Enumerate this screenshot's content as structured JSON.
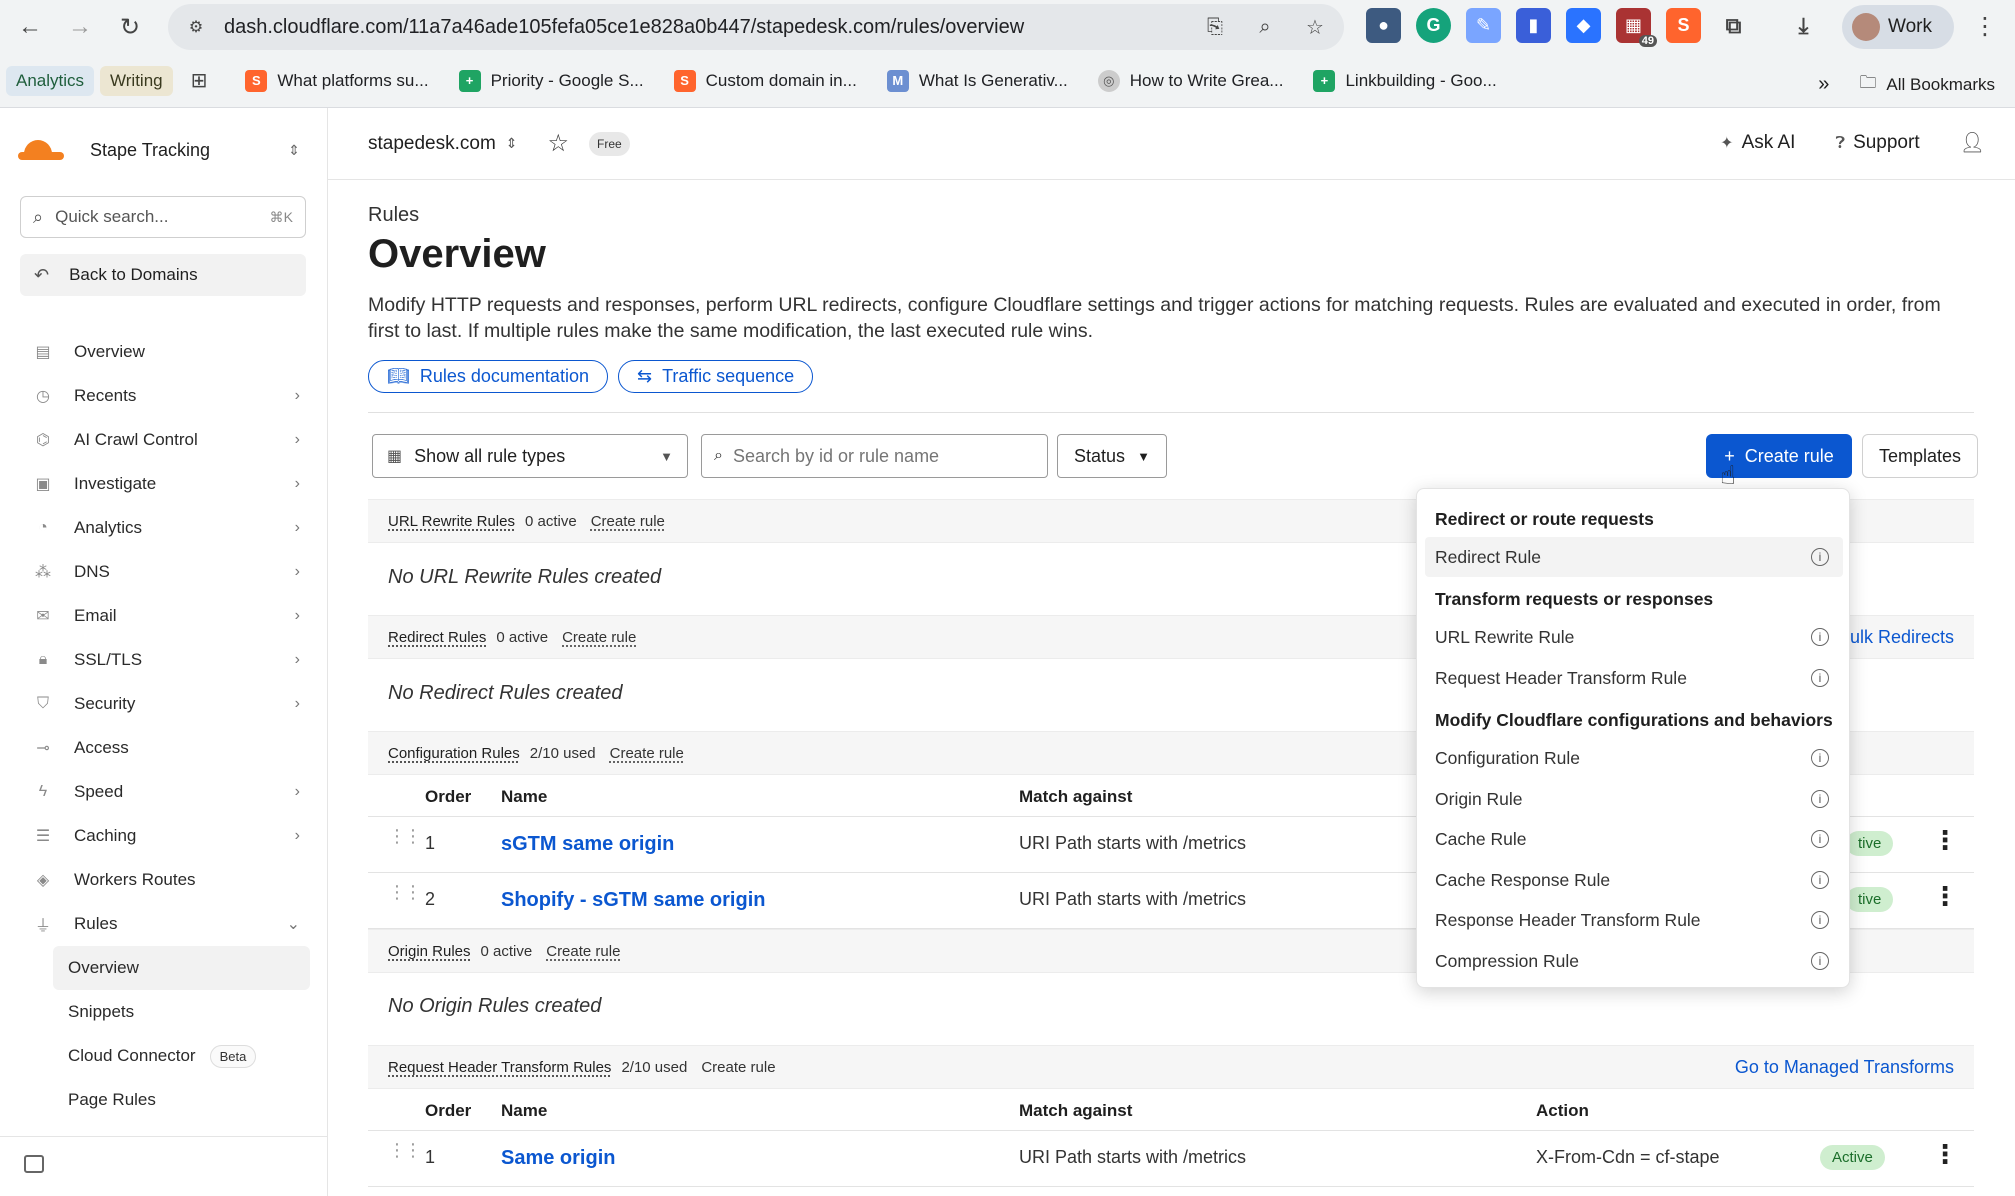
{
  "browser": {
    "url": "dash.cloudflare.com/11a7a46ade105fefa05ce1e828a0b447/stapedesk.com/rules/overview",
    "profile": "Work",
    "ext_badge": "49",
    "bookmarks_chips": [
      "Analytics",
      "Writing"
    ],
    "bookmarks": [
      "What platforms su...",
      "Priority - Google S...",
      "Custom domain in...",
      "What Is Generativ...",
      "How to Write Grea...",
      "Linkbuilding - Goo..."
    ],
    "all_bookmarks": "All Bookmarks"
  },
  "sidebar": {
    "account": "Stape Tracking",
    "search_placeholder": "Quick search...",
    "search_kbd": "⌘K",
    "back": "Back to Domains",
    "items": [
      {
        "label": "Overview",
        "icon": "document-icon",
        "chev": false
      },
      {
        "label": "Recents",
        "icon": "clock-icon",
        "chev": true
      },
      {
        "label": "AI Crawl Control",
        "icon": "robot-icon",
        "chev": true
      },
      {
        "label": "Investigate",
        "icon": "file-search-icon",
        "chev": true
      },
      {
        "label": "Analytics",
        "icon": "pie-icon",
        "chev": true
      },
      {
        "label": "DNS",
        "icon": "network-icon",
        "chev": true
      },
      {
        "label": "Email",
        "icon": "mail-icon",
        "chev": true
      },
      {
        "label": "SSL/TLS",
        "icon": "lock-icon",
        "chev": true
      },
      {
        "label": "Security",
        "icon": "shield-icon",
        "chev": true
      },
      {
        "label": "Access",
        "icon": "access-icon",
        "chev": false
      },
      {
        "label": "Speed",
        "icon": "bolt-icon",
        "chev": true
      },
      {
        "label": "Caching",
        "icon": "stack-icon",
        "chev": true
      },
      {
        "label": "Workers Routes",
        "icon": "workers-icon",
        "chev": false
      },
      {
        "label": "Rules",
        "icon": "funnel-icon",
        "chev": true
      }
    ],
    "sub_items": [
      "Overview",
      "Snippets",
      "Cloud Connector",
      "Page Rules"
    ],
    "beta": "Beta"
  },
  "topbar": {
    "domain": "stapedesk.com",
    "plan": "Free",
    "ask_ai": "Ask AI",
    "support": "Support"
  },
  "page": {
    "breadcrumb": "Rules",
    "title": "Overview",
    "description": "Modify HTTP requests and responses, perform URL redirects, configure Cloudflare settings and trigger actions for matching requests. Rules are evaluated and executed in order, from first to last. If multiple rules make the same modification, the last executed rule wins.",
    "docs_button": "Rules documentation",
    "traffic_button": "Traffic sequence",
    "filter_select": "Show all rule types",
    "search_placeholder": "Search by id or rule name",
    "status": "Status",
    "create_rule": "Create rule",
    "templates": "Templates"
  },
  "sections": {
    "url_rewrite": {
      "name": "URL Rewrite Rules",
      "count": "0 active",
      "create": "Create rule",
      "empty": "No URL Rewrite Rules created"
    },
    "redirect": {
      "name": "Redirect Rules",
      "count": "0 active",
      "create": "Create rule",
      "empty": "No Redirect Rules created",
      "link": "ulk Redirects"
    },
    "configuration": {
      "name": "Configuration Rules",
      "count": "2/10 used",
      "create": "Create rule"
    },
    "origin": {
      "name": "Origin Rules",
      "count": "0 active",
      "create": "Create rule",
      "empty": "No Origin Rules created"
    },
    "req_header": {
      "name": "Request Header Transform Rules",
      "count": "2/10 used",
      "create": "Create rule",
      "link": "Go to Managed Transforms"
    }
  },
  "columns": {
    "order": "Order",
    "name": "Name",
    "match": "Match against",
    "action": "Action"
  },
  "config_rows": [
    {
      "order": "1",
      "name": "sGTM same origin",
      "match": "URI Path starts with /metrics",
      "status": "tive"
    },
    {
      "order": "2",
      "name": "Shopify - sGTM same origin",
      "match": "URI Path starts with /metrics",
      "status": "tive"
    }
  ],
  "header_rows": [
    {
      "order": "1",
      "name": "Same origin",
      "match": "URI Path starts with /metrics",
      "action": "X-From-Cdn = cf-stape",
      "status": "Active"
    }
  ],
  "dropdown": {
    "groups": [
      {
        "title": "Redirect or route requests",
        "items": [
          "Redirect Rule"
        ]
      },
      {
        "title": "Transform requests or responses",
        "items": [
          "URL Rewrite Rule",
          "Request Header Transform Rule"
        ]
      },
      {
        "title": "Modify Cloudflare configurations and behaviors",
        "items": [
          "Configuration Rule",
          "Origin Rule",
          "Cache Rule",
          "Cache Response Rule",
          "Response Header Transform Rule",
          "Compression Rule"
        ]
      }
    ]
  }
}
